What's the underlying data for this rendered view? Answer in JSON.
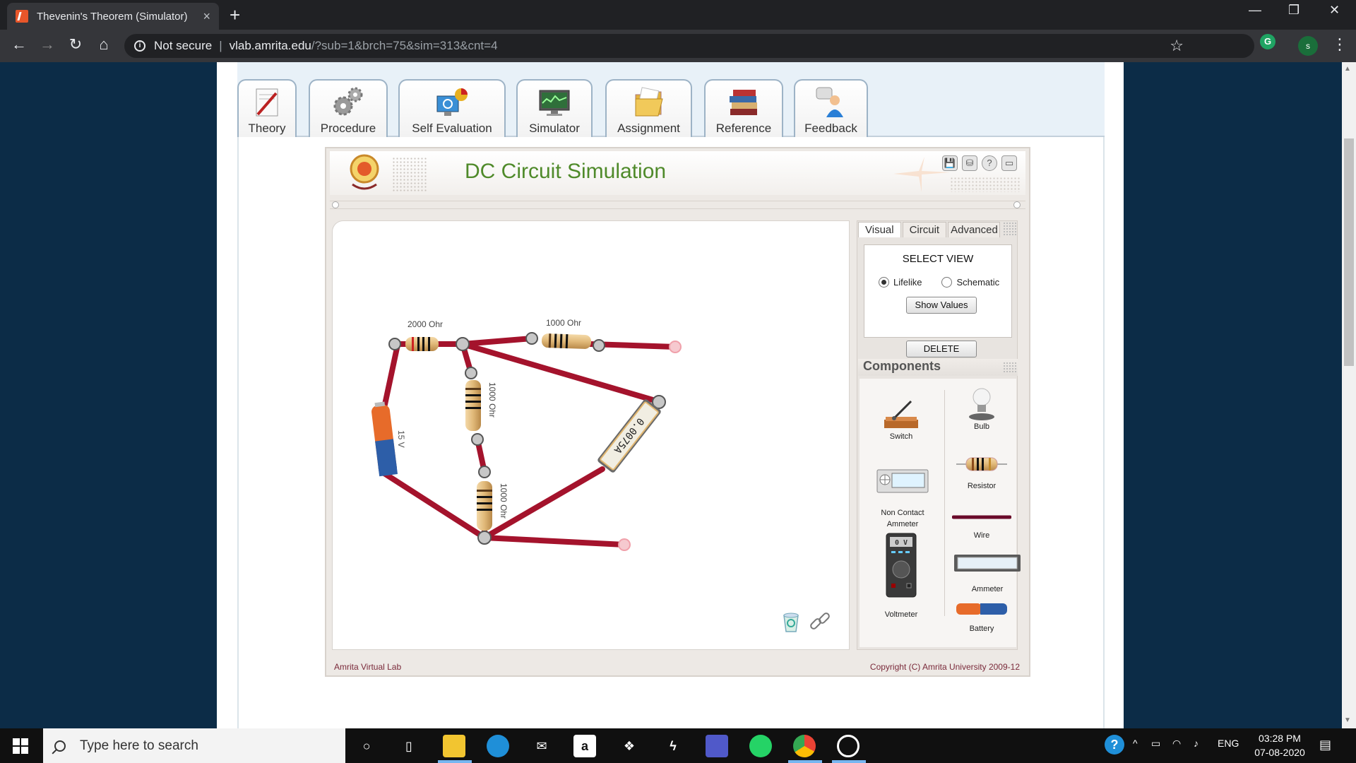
{
  "browser": {
    "tab_title": "Thevenin's Theorem (Simulator)",
    "tab_close": "×",
    "new_tab": "+",
    "security_label": "Not secure",
    "url_host": "vlab.amrita.edu",
    "url_path": "/?sub=1&brch=75&sim=313&cnt=4",
    "profile_initial": "s",
    "extension_initial": "G",
    "back": "←",
    "forward": "→",
    "reload": "↻",
    "home": "⌂",
    "bookmark": "☆",
    "menu": "⋮",
    "minimize": "—",
    "restore": "❐",
    "close": "✕"
  },
  "nav_tabs": [
    {
      "label": "Theory",
      "icon": "pen-paper-icon"
    },
    {
      "label": "Procedure",
      "icon": "gears-icon"
    },
    {
      "label": "Self Evaluation",
      "icon": "monitor-chart-icon"
    },
    {
      "label": "Simulator",
      "icon": "simulator-monitor-icon"
    },
    {
      "label": "Assignment",
      "icon": "folder-icon"
    },
    {
      "label": "Reference",
      "icon": "books-icon"
    },
    {
      "label": "Feedback",
      "icon": "feedback-person-icon"
    }
  ],
  "simulator": {
    "title": "DC Circuit Simulation",
    "header_icons": [
      "💾",
      "⛁",
      "?",
      "▭"
    ],
    "canvas_labels": {
      "r_top_left": "2000 Ohr",
      "r_top_right": "1000 Ohr",
      "r_mid_upper": "1000 Ohr",
      "r_mid_lower": "1000 Ohr",
      "battery": "15 V",
      "ammeter_reading": "0.0075A"
    },
    "panel": {
      "tabs": [
        "Visual",
        "Circuit",
        "Advanced"
      ],
      "select_view_title": "SELECT VIEW",
      "option_lifelike": "Lifelike",
      "option_schematic": "Schematic",
      "selected_view": "Lifelike",
      "show_values_button": "Show Values",
      "delete_button": "DELETE",
      "components_title": "Components"
    },
    "components": [
      {
        "label": "Switch",
        "icon": "switch-icon"
      },
      {
        "label": "Bulb",
        "icon": "bulb-icon"
      },
      {
        "label": "Resistor",
        "icon": "resistor-icon"
      },
      {
        "label": "Non Contact Ammeter",
        "icon": "non-contact-ammeter-icon"
      },
      {
        "label": "Wire",
        "icon": "wire-icon"
      },
      {
        "label": "Voltmeter",
        "icon": "voltmeter-icon",
        "display": "0 V"
      },
      {
        "label": "Ammeter",
        "icon": "ammeter-icon"
      },
      {
        "label": "Battery",
        "icon": "battery-icon"
      }
    ],
    "footer_left": "Amrita Virtual Lab",
    "footer_right": "Copyright (C) Amrita University 2009-12"
  },
  "taskbar": {
    "search_placeholder": "Type here to search",
    "language": "ENG",
    "time": "03:28 PM",
    "date": "07-08-2020",
    "amazon_glyph": "a"
  },
  "colors": {
    "wire": "#a4132c",
    "title_green": "#4f8a2a",
    "page_background": "#0c2c47"
  }
}
